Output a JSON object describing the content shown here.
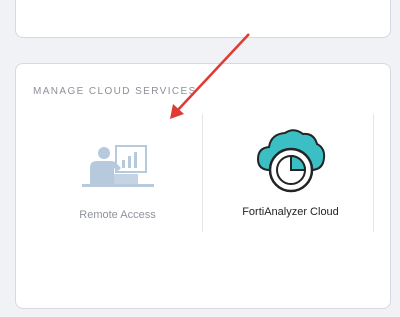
{
  "section": {
    "title": "MANAGE CLOUD SERVICES"
  },
  "tiles": [
    {
      "label": "Remote Access",
      "icon": "remote-access-icon"
    },
    {
      "label": "FortiAnalyzer Cloud",
      "icon": "fortianalyzer-cloud-icon"
    }
  ],
  "colors": {
    "background": "#f1f2f5",
    "card": "#ffffff",
    "accent_teal": "#3bbfc4",
    "muted_blue": "#b7c9dc",
    "arrow_red": "#e03a32"
  }
}
